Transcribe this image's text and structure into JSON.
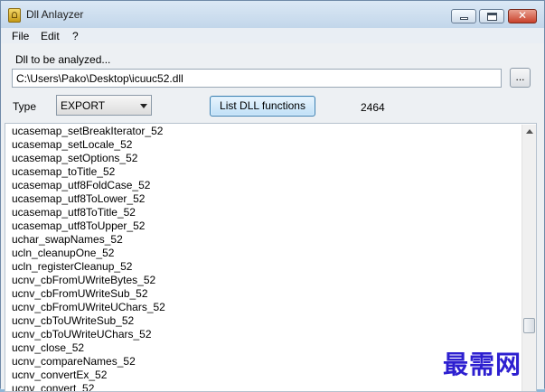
{
  "window": {
    "title": "Dll Anlayzer",
    "close_glyph": "✕"
  },
  "menu": [
    "File",
    "Edit",
    "?"
  ],
  "form": {
    "analyze_label": "Dll to be analyzed...",
    "path_value": "C:\\Users\\Pako\\Desktop\\icuuc52.dll",
    "browse_label": "...",
    "type_label": "Type",
    "type_selected": "EXPORT",
    "list_button_label": "List DLL functions",
    "function_count": "2464"
  },
  "functions": [
    "ucasemap_setBreakIterator_52",
    "ucasemap_setLocale_52",
    "ucasemap_setOptions_52",
    "ucasemap_toTitle_52",
    "ucasemap_utf8FoldCase_52",
    "ucasemap_utf8ToLower_52",
    "ucasemap_utf8ToTitle_52",
    "ucasemap_utf8ToUpper_52",
    "uchar_swapNames_52",
    "ucln_cleanupOne_52",
    "ucln_registerCleanup_52",
    "ucnv_cbFromUWriteBytes_52",
    "ucnv_cbFromUWriteSub_52",
    "ucnv_cbFromUWriteUChars_52",
    "ucnv_cbToUWriteSub_52",
    "ucnv_cbToUWriteUChars_52",
    "ucnv_close_52",
    "ucnv_compareNames_52",
    "ucnv_convertEx_52",
    "ucnv_convert_52"
  ],
  "icons": {
    "app": "app-icon",
    "minimize": "minimize-icon",
    "maximize": "maximize-icon",
    "close": "close-icon",
    "dropdown": "dropdown-arrow-icon",
    "scroll_up": "scroll-up-icon"
  },
  "watermark": "最需网",
  "colors": {
    "accent_button": "#bfe0f7",
    "close_button": "#c9412b",
    "watermark": "#2d1fd0"
  }
}
